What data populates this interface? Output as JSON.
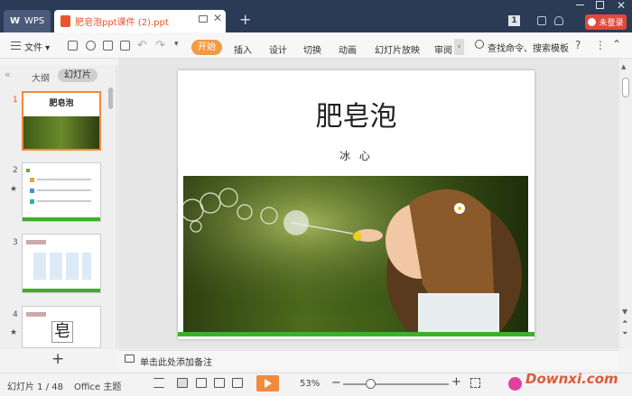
{
  "titlebar": {
    "wps_label": "WPS",
    "doc_tab_title": "肥皂泡ppt课件 (2).ppt",
    "login_label": "未登录"
  },
  "ribbon": {
    "file_menu": "文件",
    "tabs": [
      "开始",
      "插入",
      "设计",
      "切换",
      "动画",
      "幻灯片放映",
      "审阅"
    ],
    "active_tab": "开始",
    "search_label": "查找命令、搜索模板",
    "accent_color": "#f39a43"
  },
  "left_panel": {
    "outline_tab": "大纲",
    "slides_tab": "幻灯片",
    "slide_numbers": [
      "1",
      "2",
      "3",
      "4"
    ],
    "add_slide_symbol": "+"
  },
  "slide": {
    "title": "肥皂泡",
    "author": "冰 心"
  },
  "notes": {
    "placeholder": "单击此处添加备注"
  },
  "statusbar": {
    "slide_counter": "幻灯片 1 / 48",
    "theme": "Office 主题",
    "zoom": "53%",
    "watermark": "Downxi.com"
  }
}
